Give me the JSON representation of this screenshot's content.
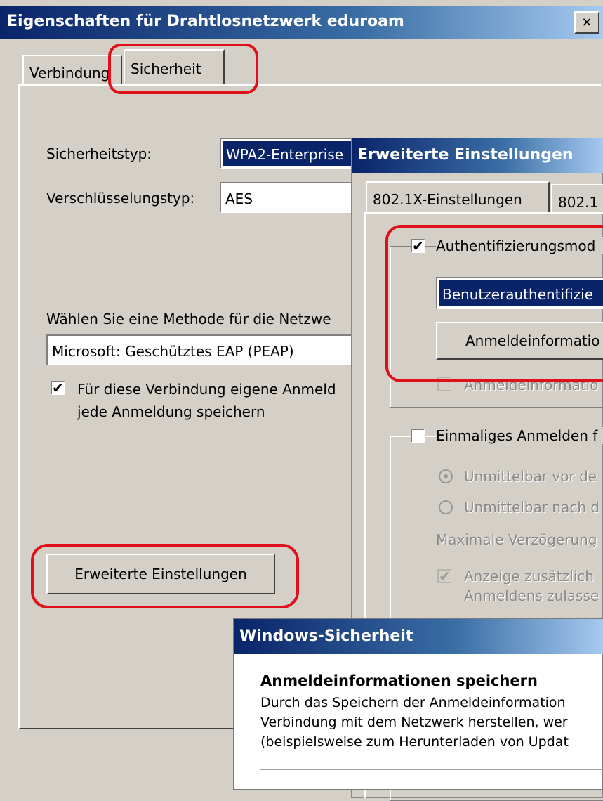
{
  "main_window": {
    "title": "Eigenschaften für Drahtlosnetzwerk eduroam",
    "close_glyph": "✕",
    "tabs": [
      {
        "label": "Verbindung"
      },
      {
        "label": "Sicherheit"
      }
    ],
    "security_type_label": "Sicherheitstyp:",
    "security_type_value": "WPA2-Enterprise",
    "encryption_type_label": "Verschlüsselungstyp:",
    "encryption_type_value": "AES",
    "auth_method_label": "Wählen Sie eine Methode für die Netzwe",
    "auth_method_value": "Microsoft: Geschütztes EAP (PEAP)",
    "remember_credentials_label_line1": "Für diese Verbindung eigene Anmeld",
    "remember_credentials_label_line2": "jede Anmeldung speichern",
    "remember_credentials_checked": true,
    "advanced_button": "Erweiterte Einstellungen"
  },
  "advanced_window": {
    "title": "Erweiterte Einstellungen",
    "tabs": [
      {
        "label": "802.1X-Einstellungen"
      },
      {
        "label": "802.1"
      }
    ],
    "auth_mode_label": "Authentifizierungsmod",
    "auth_mode_checked": true,
    "auth_mode_value": "Benutzerauthentifizie",
    "credentials_button": "Anmeldeinformatio",
    "credentials_partial": "Anmeldeinformatio",
    "sso_label": "Einmaliges Anmelden f",
    "sso_checked": false,
    "radio_before_label": "Unmittelbar vor de",
    "radio_after_label": "Unmittelbar nach d",
    "max_delay_label": "Maximale Verzögerung",
    "additional_dialogs_line1": "Anzeige zusätzlich",
    "additional_dialogs_line2": "Anmeldens zulasse"
  },
  "security_window": {
    "title": "Windows-Sicherheit",
    "heading": "Anmeldeinformationen speichern",
    "body_line1": "Durch das Speichern der Anmeldeinformation",
    "body_line2": "Verbindung mit dem Netzwerk herstellen, wer",
    "body_line3": "(beispielsweise zum Herunterladen von Updat"
  },
  "colors": {
    "highlight": "#e0101a",
    "title_gradient_start": "#0a246a",
    "selection": "#0a246a"
  }
}
